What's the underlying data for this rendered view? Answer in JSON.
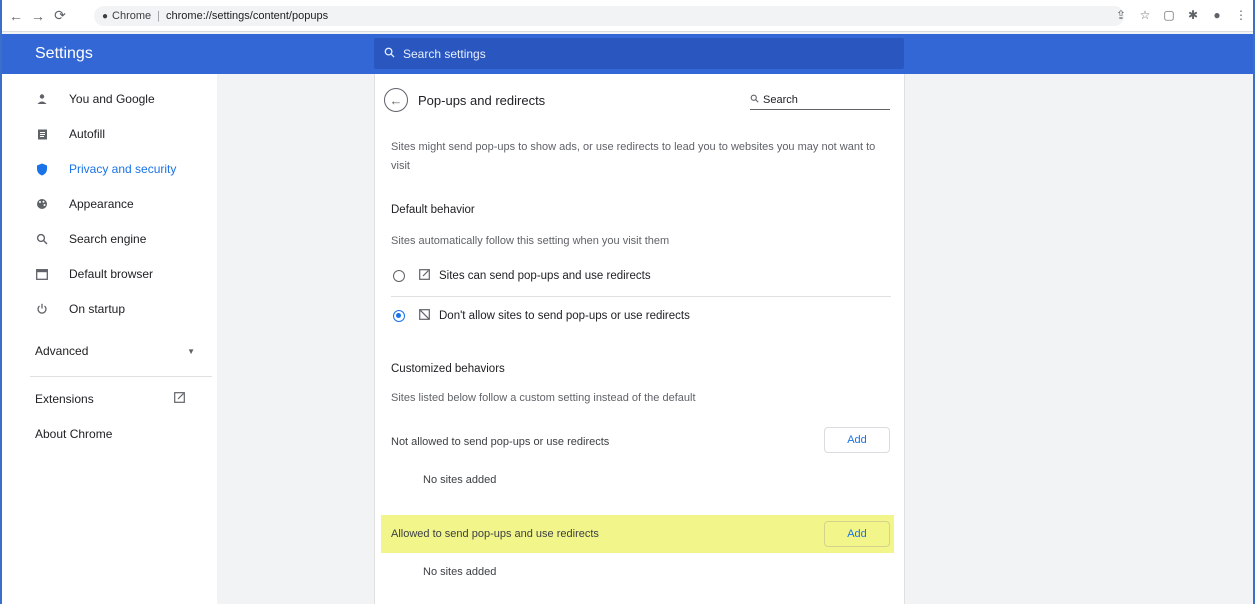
{
  "browser": {
    "chip_label": "Chrome",
    "url_path": "chrome://settings/content/popups"
  },
  "header": {
    "title": "Settings",
    "search_placeholder": "Search settings"
  },
  "sidebar": {
    "items": [
      {
        "label": "You and Google",
        "icon": "person-icon"
      },
      {
        "label": "Autofill",
        "icon": "clipboard-icon"
      },
      {
        "label": "Privacy and security",
        "icon": "shield-icon"
      },
      {
        "label": "Appearance",
        "icon": "palette-icon"
      },
      {
        "label": "Search engine",
        "icon": "search-icon"
      },
      {
        "label": "Default browser",
        "icon": "browser-icon"
      },
      {
        "label": "On startup",
        "icon": "power-icon"
      }
    ],
    "advanced_label": "Advanced",
    "extensions_label": "Extensions",
    "about_label": "About Chrome"
  },
  "page": {
    "title": "Pop-ups and redirects",
    "search_label": "Search",
    "intro": "Sites might send pop-ups to show ads, or use redirects to lead you to websites you may not want to visit",
    "default_heading": "Default behavior",
    "default_desc": "Sites automatically follow this setting when you visit them",
    "option_allow": "Sites can send pop-ups and use redirects",
    "option_block": "Don't allow sites to send pop-ups or use redirects",
    "custom_heading": "Customized behaviors",
    "custom_desc": "Sites listed below follow a custom setting instead of the default",
    "not_allowed_label": "Not allowed to send pop-ups or use redirects",
    "allowed_label": "Allowed to send pop-ups and use redirects",
    "add_label": "Add",
    "no_sites": "No sites added"
  },
  "colors": {
    "header_blue": "#3367d6",
    "accent": "#1a73e8",
    "highlight": "#f2f58a"
  }
}
